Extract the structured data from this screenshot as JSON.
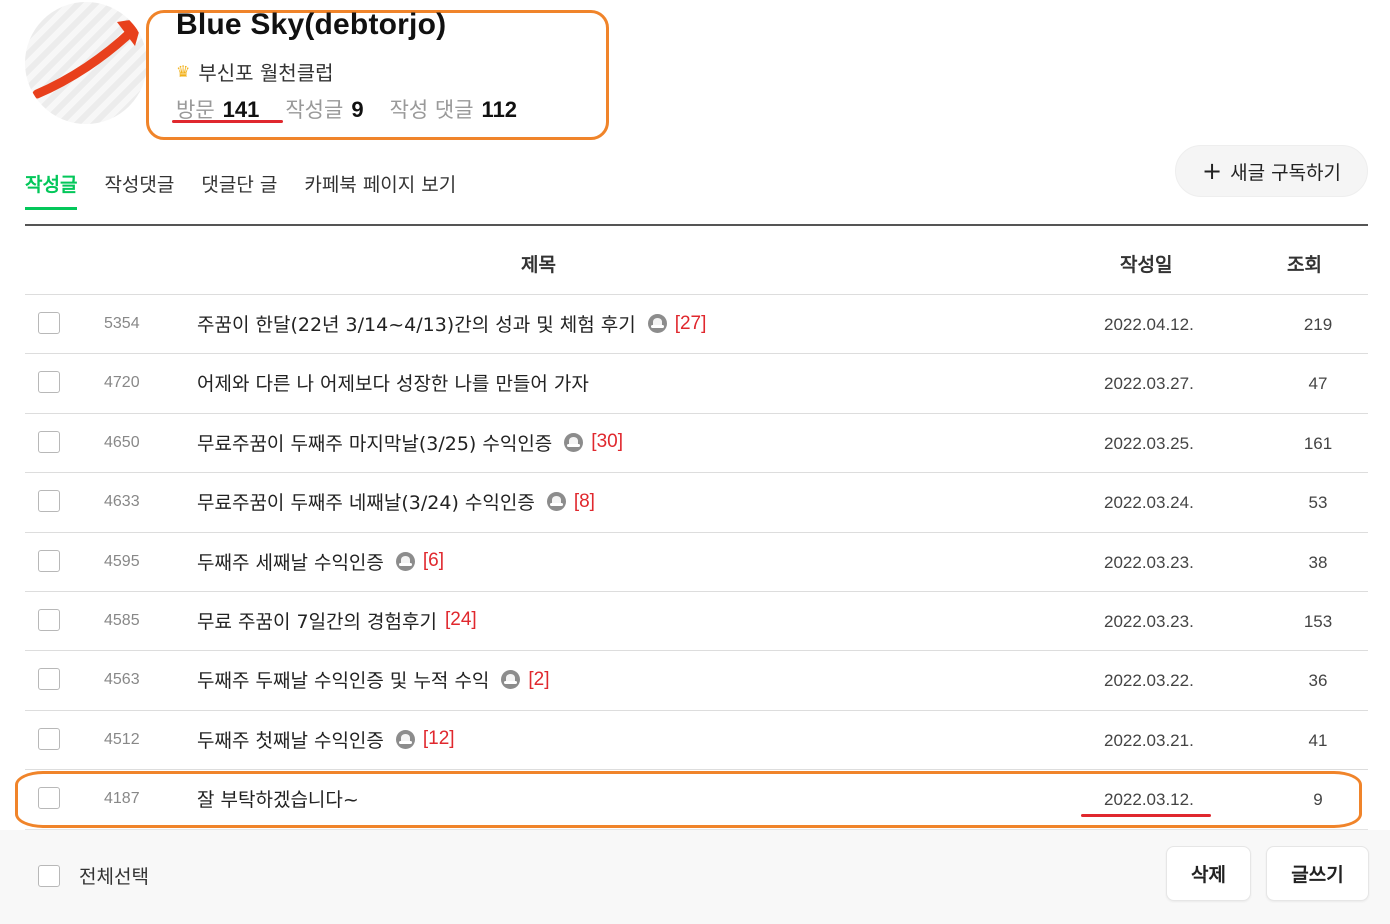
{
  "profile": {
    "nickname": "Blue Sky(debtorjo)",
    "grade_icon": "crown-icon",
    "grade": "부신포 월천클럽",
    "stats": [
      {
        "label": "방문",
        "value": "141"
      },
      {
        "label": "작성글",
        "value": "9"
      },
      {
        "label": "작성 댓글",
        "value": "112"
      }
    ]
  },
  "tabs": [
    {
      "label": "작성글",
      "active": true
    },
    {
      "label": "작성댓글",
      "active": false
    },
    {
      "label": "댓글단 글",
      "active": false
    },
    {
      "label": "카페북 페이지 보기",
      "active": false
    }
  ],
  "subscribe": {
    "icon": "plus-icon",
    "label": "새글 구독하기"
  },
  "table": {
    "headers": {
      "title": "제목",
      "date": "작성일",
      "views": "조회"
    },
    "rows": [
      {
        "num": "5354",
        "title": "주꿈이 한달(22년 3/14~4/13)간의 성과 및 체험 후기",
        "has_image": true,
        "comments": "[27]",
        "date": "2022.04.12.",
        "views": "219"
      },
      {
        "num": "4720",
        "title": "어제와 다른 나 어제보다 성장한 나를 만들어 가자",
        "has_image": false,
        "comments": "",
        "date": "2022.03.27.",
        "views": "47"
      },
      {
        "num": "4650",
        "title": "무료주꿈이 두째주 마지막날(3/25) 수익인증",
        "has_image": true,
        "comments": "[30]",
        "date": "2022.03.25.",
        "views": "161"
      },
      {
        "num": "4633",
        "title": "무료주꿈이 두째주 네째날(3/24) 수익인증",
        "has_image": true,
        "comments": "[8]",
        "date": "2022.03.24.",
        "views": "53"
      },
      {
        "num": "4595",
        "title": "두째주 세째날 수익인증",
        "has_image": true,
        "comments": "[6]",
        "date": "2022.03.23.",
        "views": "38"
      },
      {
        "num": "4585",
        "title": "무료 주꿈이 7일간의 경험후기",
        "has_image": false,
        "comments": "[24]",
        "date": "2022.03.23.",
        "views": "153"
      },
      {
        "num": "4563",
        "title": "두째주 두째날 수익인증 및 누적 수익",
        "has_image": true,
        "comments": "[2]",
        "date": "2022.03.22.",
        "views": "36"
      },
      {
        "num": "4512",
        "title": "두째주 첫째날 수익인증",
        "has_image": true,
        "comments": "[12]",
        "date": "2022.03.21.",
        "views": "41"
      },
      {
        "num": "4187",
        "title": "잘 부탁하겠습니다~",
        "has_image": false,
        "comments": "",
        "date": "2022.03.12.",
        "views": "9"
      }
    ]
  },
  "footer": {
    "select_all": "전체선택",
    "delete_label": "삭제",
    "write_label": "글쓰기"
  },
  "colors": {
    "accent_green": "#03c75a",
    "comment_red": "#e0282e",
    "annotation_orange": "#f0842a",
    "annotation_red": "#e0282e"
  }
}
